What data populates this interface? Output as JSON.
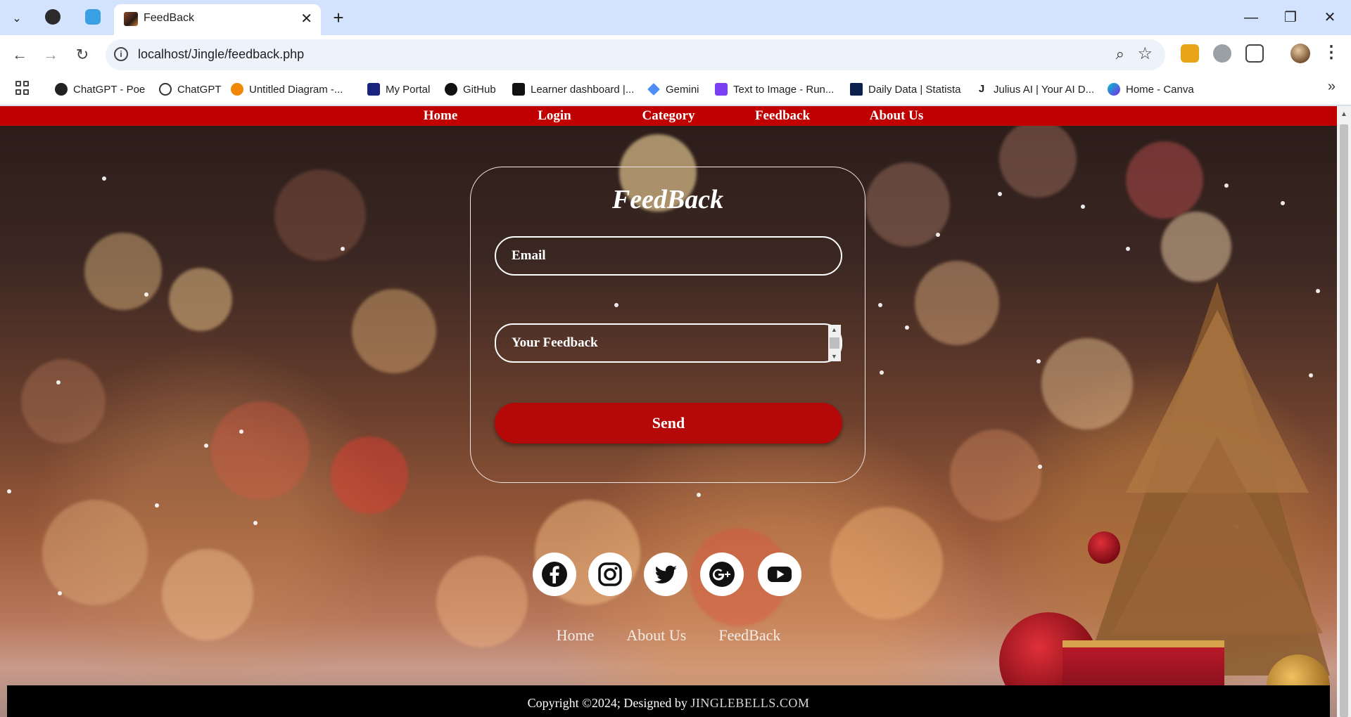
{
  "browser": {
    "tab_title": "FeedBack",
    "url": "localhost/Jingle/feedback.php",
    "bookmarks": [
      "ChatGPT - Poe",
      "ChatGPT",
      "Untitled Diagram -...",
      "My Portal",
      "GitHub",
      "Learner dashboard |...",
      "Gemini",
      "Text to Image - Run...",
      "Daily Data | Statista",
      "Julius AI | Your AI D...",
      "Home - Canva"
    ]
  },
  "site_nav": [
    "Home",
    "Login",
    "Category",
    "Feedback",
    "About Us"
  ],
  "form": {
    "title": "FeedBack",
    "email_placeholder": "Email",
    "feedback_placeholder": "Your Feedback",
    "send_label": "Send"
  },
  "social_icons": [
    "facebook-icon",
    "instagram-icon",
    "twitter-icon",
    "google-plus-icon",
    "youtube-icon"
  ],
  "footer_links": [
    "Home",
    "About Us",
    "FeedBack"
  ],
  "copyright": {
    "text": "Copyright ©2024; Designed by",
    "brand": "JINGLEBELLS.COM"
  },
  "colors": {
    "nav_red": "#c00000",
    "button_red": "#b50808",
    "footer_black": "#000000"
  }
}
